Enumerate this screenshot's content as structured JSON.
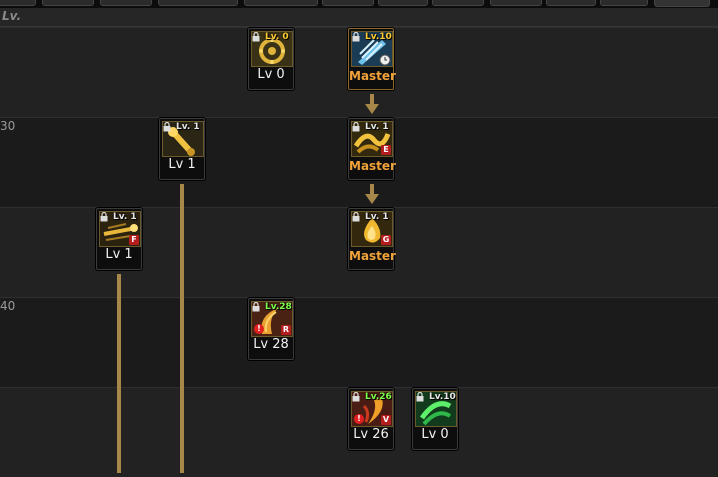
{
  "header": {
    "lv_label": "Lv."
  },
  "rows": [
    {
      "label": "30"
    },
    {
      "label": "40"
    }
  ],
  "colors": {
    "line": "#a8874a",
    "master": "#f0a23a",
    "badge": "#b41d1d"
  },
  "skills": [
    {
      "icon": "gear-ring-icon",
      "lock_label": "Lv. 0",
      "caption": "Lv 0"
    },
    {
      "icon": "drill-spiral-icon",
      "lock_label": "Lv.10",
      "caption": "Master"
    },
    {
      "icon": "golden-bone-icon",
      "lock_label": "Lv. 1",
      "caption": "Lv 1"
    },
    {
      "icon": "serpent-wave-icon",
      "lock_label": "Lv. 1",
      "letter": "E",
      "caption": "Master"
    },
    {
      "icon": "dash-slash-icon",
      "lock_label": "Lv. 1",
      "letter": "F",
      "caption": "Lv 1"
    },
    {
      "icon": "golden-flame-icon",
      "lock_label": "Lv. 1",
      "letter": "G",
      "caption": "Master"
    },
    {
      "icon": "red-horn-icon",
      "lock_label": "Lv.28",
      "letter": "R",
      "warn": "!",
      "caption": "Lv 28"
    },
    {
      "icon": "red-claw-icon",
      "lock_label": "Lv.26",
      "letter": "V",
      "warn": "!",
      "caption": "Lv 26"
    },
    {
      "icon": "green-whirl-icon",
      "lock_label": "Lv.10",
      "caption": "Lv 0"
    }
  ]
}
